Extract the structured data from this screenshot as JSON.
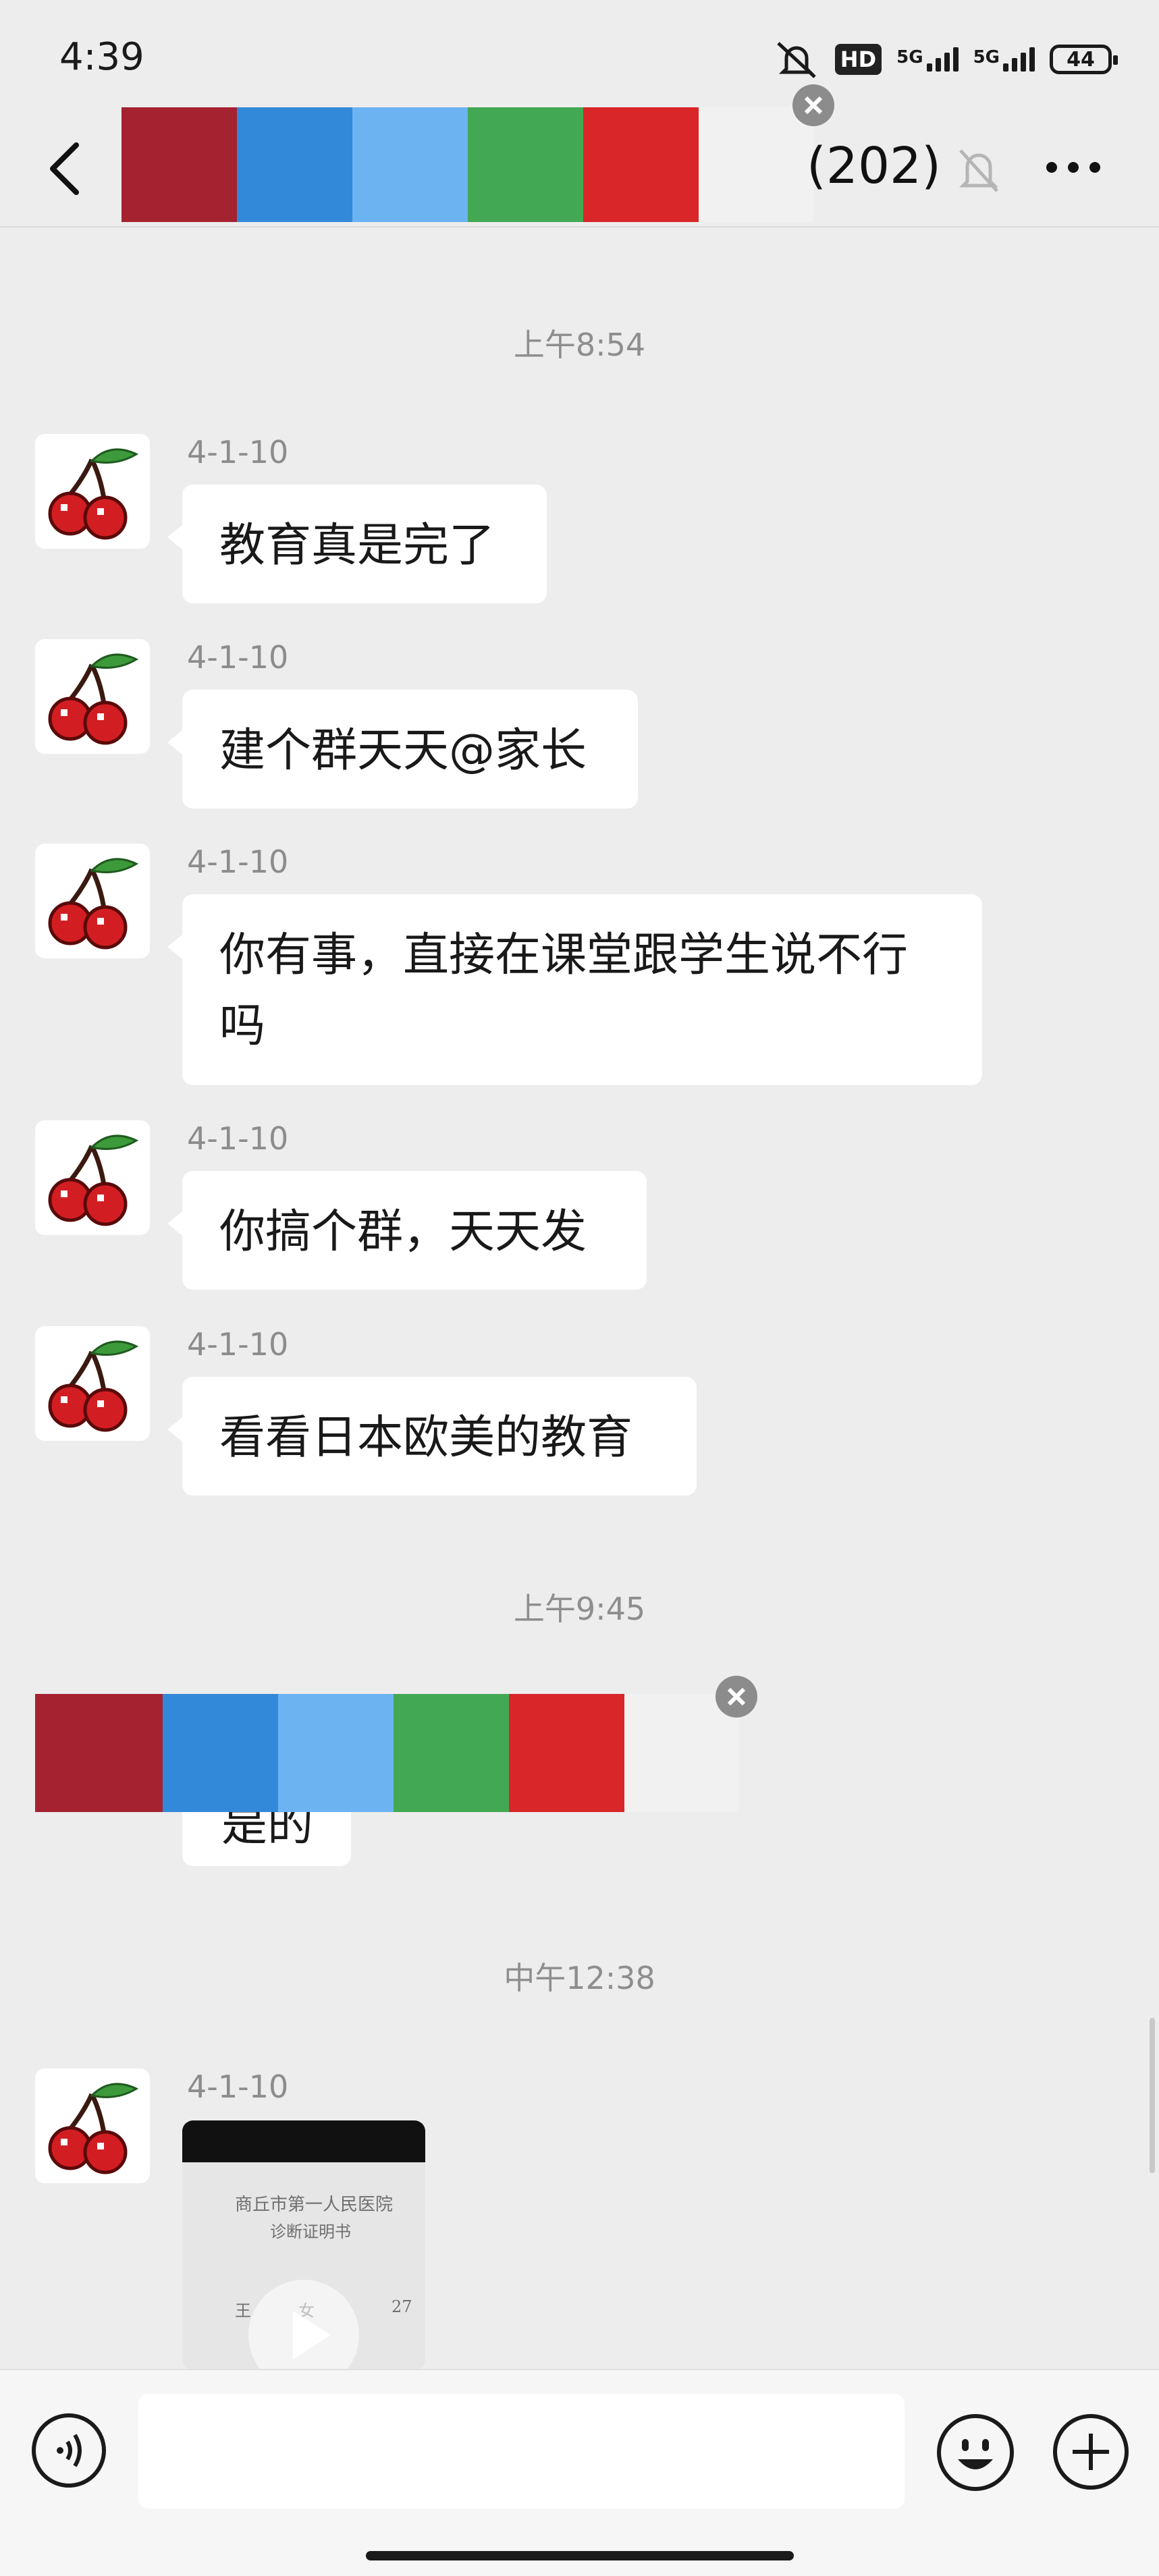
{
  "status_bar": {
    "time": "4:39",
    "hd_label": "HD",
    "network_5g_1": "5G",
    "network_5g_2": "5G",
    "battery": "44"
  },
  "nav": {
    "title_suffix": "(202)",
    "censor_colors": [
      "#a52231",
      "#3389d9",
      "#6cb3f2",
      "#43a854",
      "#d92629",
      "#f1f1f1"
    ]
  },
  "chat": {
    "time_1": "上午8:54",
    "messages": [
      {
        "sender": "4-1-10",
        "text": "教育真是完了"
      },
      {
        "sender": "4-1-10",
        "text": "建个群天天@家长"
      },
      {
        "sender": "4-1-10",
        "text_line1": "你有事，直接在课堂跟学生说不行",
        "text_line2": "吗"
      },
      {
        "sender": "4-1-10",
        "text": "你搞个群，天天发"
      },
      {
        "sender": "4-1-10",
        "text": "看看日本欧美的教育"
      }
    ],
    "time_2": "上午9:45",
    "partial_text": "是的",
    "time_3": "中午12:38",
    "video_sender": "4-1-10",
    "video_doc": {
      "title": "商丘市第一人民医院",
      "subtitle": "诊断证明书",
      "name": "王",
      "gender": "女",
      "age": "27"
    }
  },
  "input_bar": {
    "placeholder": ""
  }
}
